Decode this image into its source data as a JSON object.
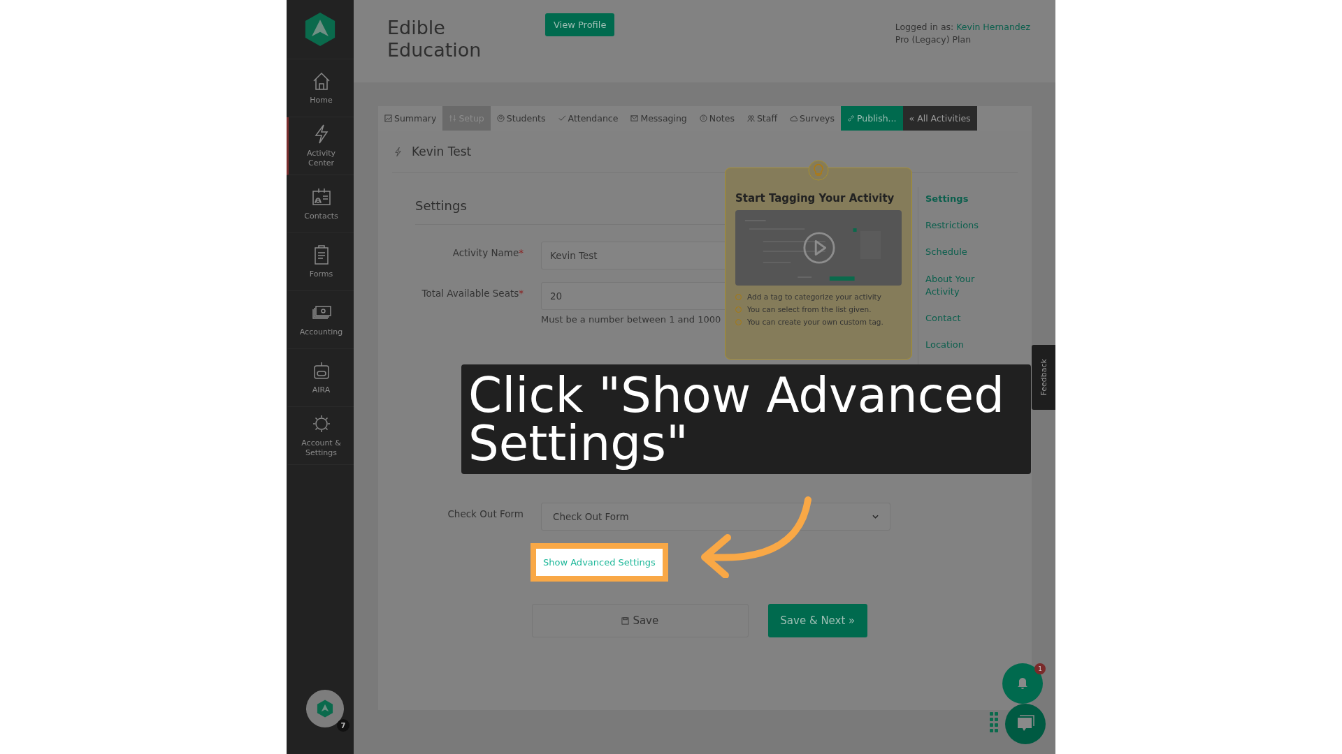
{
  "sidebar": {
    "items": [
      {
        "label": "Home",
        "selected": false
      },
      {
        "label": "Activity Center",
        "selected": true
      },
      {
        "label": "Contacts",
        "selected": false
      },
      {
        "label": "Forms",
        "selected": false
      },
      {
        "label": "Accounting",
        "selected": false
      },
      {
        "label": "AIRA",
        "selected": false
      },
      {
        "label": "Account & Settings",
        "selected": false
      }
    ],
    "avatar_badge": "7"
  },
  "header": {
    "title": "Edible Education",
    "view_profile": "View Profile",
    "logged_in_label": "Logged in as:",
    "user_name": "Kevin Hernandez",
    "plan": "Pro (Legacy) Plan"
  },
  "tabs": [
    {
      "label": "Summary",
      "selected": false,
      "kind": "normal"
    },
    {
      "label": "Setup",
      "selected": true,
      "kind": "normal"
    },
    {
      "label": "Students",
      "selected": false,
      "kind": "normal"
    },
    {
      "label": "Attendance",
      "selected": false,
      "kind": "normal"
    },
    {
      "label": "Messaging",
      "selected": false,
      "kind": "normal"
    },
    {
      "label": "Notes",
      "selected": false,
      "kind": "normal"
    },
    {
      "label": "Staff",
      "selected": false,
      "kind": "normal"
    },
    {
      "label": "Surveys",
      "selected": false,
      "kind": "normal"
    },
    {
      "label": "Publish...",
      "selected": false,
      "kind": "publish"
    },
    {
      "label": "« All Activities",
      "selected": false,
      "kind": "back"
    }
  ],
  "activity_title": "Kevin Test",
  "section_title": "Settings",
  "form": [
    {
      "kind": "text",
      "label": "Activity Name",
      "required_mark": "*",
      "value": "Kevin Test"
    },
    {
      "kind": "text",
      "label": "Total Available Seats",
      "required_mark": "*",
      "value": "20",
      "hint": "Must be a number between 1 and 1000"
    },
    {
      "kind": "hidden"
    },
    {
      "kind": "select",
      "label": "Check Out Form",
      "value": "Check Out Form"
    }
  ],
  "advanced_link": "Show Advanced Settings",
  "buttons": {
    "save": "Save",
    "save_next": "Save & Next »"
  },
  "tooltip": {
    "title": "Start Tagging Your Activity",
    "video": {
      "kind": "picture"
    },
    "steps": [
      "Add a tag to categorize your activity",
      "You can select from the list given.",
      "You can create your own custom tag."
    ]
  },
  "section_nav": [
    {
      "label": "Settings",
      "selected": true
    },
    {
      "label": "Restrictions",
      "selected": false
    },
    {
      "label": "Schedule",
      "selected": false
    },
    {
      "label": "About Your Activity",
      "selected": false
    },
    {
      "label": "Contact",
      "selected": false
    },
    {
      "label": "Location",
      "selected": false
    }
  ],
  "feedback_tab": "Feedback",
  "notification_badge": "1",
  "caption": "Click \"Show Advanced Settings\""
}
